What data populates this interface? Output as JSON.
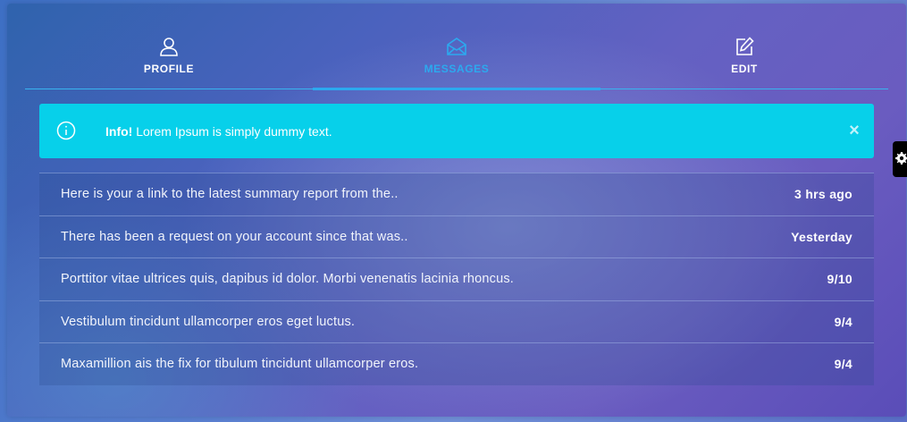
{
  "tabs": [
    {
      "label": "PROFILE",
      "icon": "user-icon",
      "active": false
    },
    {
      "label": "MESSAGES",
      "icon": "envelope-open-icon",
      "active": true
    },
    {
      "label": "EDIT",
      "icon": "edit-icon",
      "active": false
    }
  ],
  "alert": {
    "strong": "Info!",
    "text": " Lorem Ipsum is simply dummy text.",
    "close_label": "×",
    "color": "#07d0ea"
  },
  "messages": [
    {
      "text": "Here is your a link to the latest summary report from the..",
      "time": "3 hrs ago"
    },
    {
      "text": "There has been a request on your account since that was..",
      "time": "Yesterday"
    },
    {
      "text": "Porttitor vitae ultrices quis, dapibus id dolor. Morbi venenatis lacinia rhoncus.",
      "time": "9/10"
    },
    {
      "text": "Vestibulum tincidunt ullamcorper eros eget luctus.",
      "time": "9/4"
    },
    {
      "text": "Maxamillion ais the fix for tibulum tincidunt ullamcorper eros.",
      "time": "9/4"
    }
  ],
  "colors": {
    "accent": "#2ca9ef",
    "alert_bg": "#07d0ea"
  },
  "side_tab": {
    "icon": "gear-icon"
  }
}
